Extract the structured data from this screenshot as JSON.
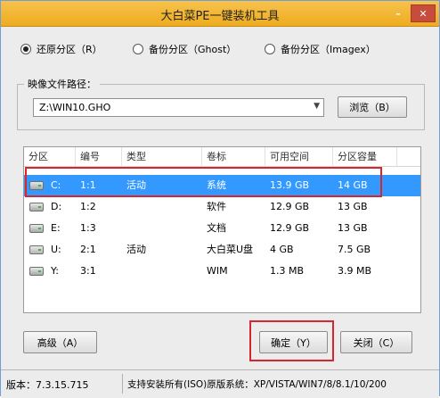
{
  "window": {
    "title": "大白菜PE一键装机工具",
    "minimize_icon": "minimize-icon",
    "close_icon": "close-icon"
  },
  "modes": [
    {
      "label": "还原分区（R）",
      "selected": true
    },
    {
      "label": "备份分区（Ghost）",
      "selected": false
    },
    {
      "label": "备份分区（Imagex）",
      "selected": false
    }
  ],
  "image_path": {
    "legend": "映像文件路径：",
    "value": "Z:\\WIN10.GHO",
    "browse_label": "浏览（B）"
  },
  "partitions": {
    "columns": [
      "分区",
      "编号",
      "类型",
      "卷标",
      "可用空间",
      "分区容量"
    ],
    "rows": [
      {
        "drive": "C:",
        "num": "1:1",
        "type": "活动",
        "label": "系统",
        "free": "13.9 GB",
        "size": "14 GB",
        "selected": true,
        "icon": "hard-drive-icon"
      },
      {
        "drive": "D:",
        "num": "1:2",
        "type": "",
        "label": "软件",
        "free": "12.9 GB",
        "size": "13 GB",
        "selected": false,
        "icon": "hard-drive-icon"
      },
      {
        "drive": "E:",
        "num": "1:3",
        "type": "",
        "label": "文档",
        "free": "12.9 GB",
        "size": "13 GB",
        "selected": false,
        "icon": "hard-drive-icon"
      },
      {
        "drive": "U:",
        "num": "2:1",
        "type": "活动",
        "label": "大白菜U盘",
        "free": "4 GB",
        "size": "7.5 GB",
        "selected": false,
        "icon": "usb-drive-icon"
      },
      {
        "drive": "Y:",
        "num": "3:1",
        "type": "",
        "label": "WIM",
        "free": "1.3 MB",
        "size": "3.9 MB",
        "selected": false,
        "icon": "hard-drive-icon"
      }
    ]
  },
  "buttons": {
    "advanced": "高级（A）",
    "ok": "确定（Y）",
    "close": "关闭（C）"
  },
  "status": {
    "version": "版本：7.3.15.715",
    "support": "支持安装所有(ISO)原版系统：XP/VISTA/WIN7/8/8.1/10/200"
  },
  "highlight_color": "#d8262e"
}
